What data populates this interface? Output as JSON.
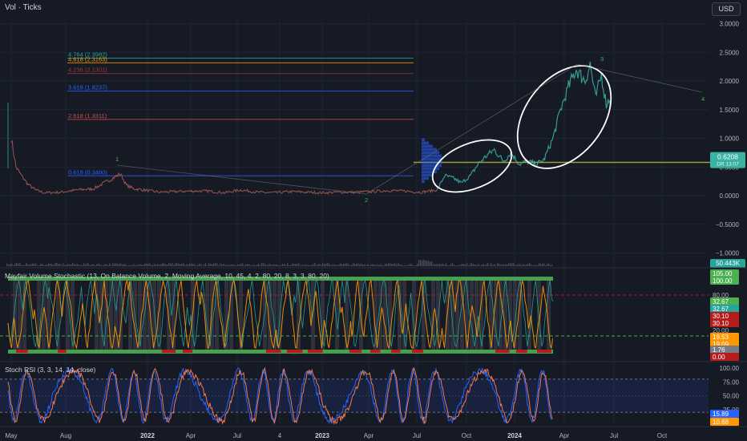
{
  "header": {
    "symbol": "Vol · Ticks",
    "currency": "USD"
  },
  "colors": {
    "background": "#161a25",
    "grid": "#1f2433",
    "price_line": "#9e5650",
    "price_dense": "#3bb3a3",
    "volume_profile": "#2962ff",
    "green_band": "#4caf50",
    "red_band": "#b71c1c",
    "stoch_orange": "#ff9800",
    "rsi_blue": "#2962ff",
    "rsi_orange": "#f0794e",
    "annotation": "#ffffff"
  },
  "main_chart": {
    "y_ticks": [
      "3.0000",
      "2.5000",
      "2.0000",
      "1.5000",
      "1.0000",
      "0.5000",
      "0.0000",
      "−0.5000",
      "−1.0000"
    ],
    "last_price": "0.6208",
    "last_price_sub": "DR 13.07",
    "fib_levels": [
      {
        "label": "4.764 (2.3982)",
        "value": 2.3982,
        "color": "#26a69a"
      },
      {
        "label": "4.618 (2.3163)",
        "value": 2.3163,
        "color": "#ff9800"
      },
      {
        "label": "4.236 (2.1301)",
        "value": 2.1301,
        "color": "#9e3a3a"
      },
      {
        "label": "3.618 (1.8237)",
        "value": 1.8237,
        "color": "#2962ff"
      },
      {
        "label": "2.618 (1.3311)",
        "value": 1.3311,
        "color": "#d44d4d"
      },
      {
        "label": "0.618 (0.3460)",
        "value": 0.346,
        "color": "#2962ff"
      }
    ],
    "wave_labels": [
      "1",
      "2",
      "3",
      "4"
    ]
  },
  "volume_strip": {
    "value_label": "50.443K"
  },
  "stochastic_panel": {
    "title": "Mayfair Volume Stochastic (13, On Balance Volume, 2, Moving Average, 10, 45, 4, 2, 80, 20, 8, 3, 3, 80, 20)",
    "badges": [
      {
        "text": "105.00",
        "color": "#4caf50"
      },
      {
        "text": "100.00",
        "color": "#4caf50"
      },
      {
        "text": "80.00",
        "color": "#161a25"
      },
      {
        "text": "32.67",
        "color": "#4caf50"
      },
      {
        "text": "32.67",
        "color": "#26a69a"
      },
      {
        "text": "30.10",
        "color": "#b71c1c"
      },
      {
        "text": "30.10",
        "color": "#b71c1c"
      },
      {
        "text": "20.00",
        "color": "#161a25"
      },
      {
        "text": "19.53",
        "color": "#ff9800"
      },
      {
        "text": "19.09",
        "color": "#ff9800"
      },
      {
        "text": "1.76",
        "color": "#787b86"
      },
      {
        "text": "0.00",
        "color": "#b71c1c"
      }
    ]
  },
  "rsi_panel": {
    "title": "Stoch RSI (3, 3, 14, 14, close)",
    "y_ticks": [
      "100.00",
      "75.00",
      "50.00",
      "25.00"
    ],
    "badge_k": "15.89",
    "badge_d": "10.88"
  },
  "time_axis": [
    "May",
    "Aug",
    "2022",
    "Apr",
    "Jul",
    "4",
    "2023",
    "Apr",
    "Jul",
    "Oct",
    "2024",
    "Apr",
    "Jul",
    "Oct"
  ],
  "chart_data": {
    "type": "line",
    "title": "",
    "xlabel": "",
    "ylabel": "",
    "x_range": [
      "2021-05",
      "2024-11"
    ],
    "ylim": [
      -1.2,
      3.2
    ],
    "grid": true,
    "series": [
      {
        "x": [
          "2021-05-01",
          "2021-05-10",
          "2021-05-20",
          "2021-06-01",
          "2021-06-15",
          "2021-07-01",
          "2021-08-01",
          "2021-09-01",
          "2021-10-01",
          "2021-11-01",
          "2021-11-20",
          "2021-12-01",
          "2021-12-15",
          "2022-01-01",
          "2022-02-01",
          "2022-03-01",
          "2022-04-01",
          "2022-05-01",
          "2022-06-01",
          "2022-07-01",
          "2022-08-01",
          "2022-09-01",
          "2022-10-01",
          "2022-11-01",
          "2022-12-01",
          "2023-01-01",
          "2023-02-01",
          "2023-03-01",
          "2023-04-01",
          "2023-05-01",
          "2023-06-01",
          "2023-07-01",
          "2023-07-15",
          "2023-08-01",
          "2023-08-15",
          "2023-09-01",
          "2023-09-15",
          "2023-10-01",
          "2023-10-15",
          "2023-11-01",
          "2023-11-15",
          "2023-12-01",
          "2023-12-15",
          "2024-01-01",
          "2024-01-15",
          "2024-02-01",
          "2024-02-15",
          "2024-03-01",
          "2024-03-15",
          "2024-04-01",
          "2024-04-10",
          "2024-04-20",
          "2024-05-01",
          "2024-05-10",
          "2024-05-20"
        ],
        "y": [
          1.0,
          0.5,
          0.35,
          0.2,
          0.1,
          0.05,
          0.06,
          0.1,
          0.12,
          0.28,
          0.38,
          0.18,
          0.12,
          0.1,
          0.06,
          0.07,
          0.08,
          0.08,
          0.05,
          0.1,
          0.06,
          0.05,
          0.07,
          0.06,
          0.05,
          0.06,
          0.06,
          0.07,
          0.09,
          0.08,
          0.06,
          0.1,
          0.35,
          0.3,
          0.22,
          0.35,
          0.55,
          0.7,
          0.8,
          0.6,
          0.75,
          0.55,
          0.6,
          0.55,
          0.62,
          1.0,
          1.5,
          1.9,
          2.2,
          2.0,
          2.3,
          1.7,
          2.1,
          1.6,
          1.75
        ]
      }
    ]
  }
}
